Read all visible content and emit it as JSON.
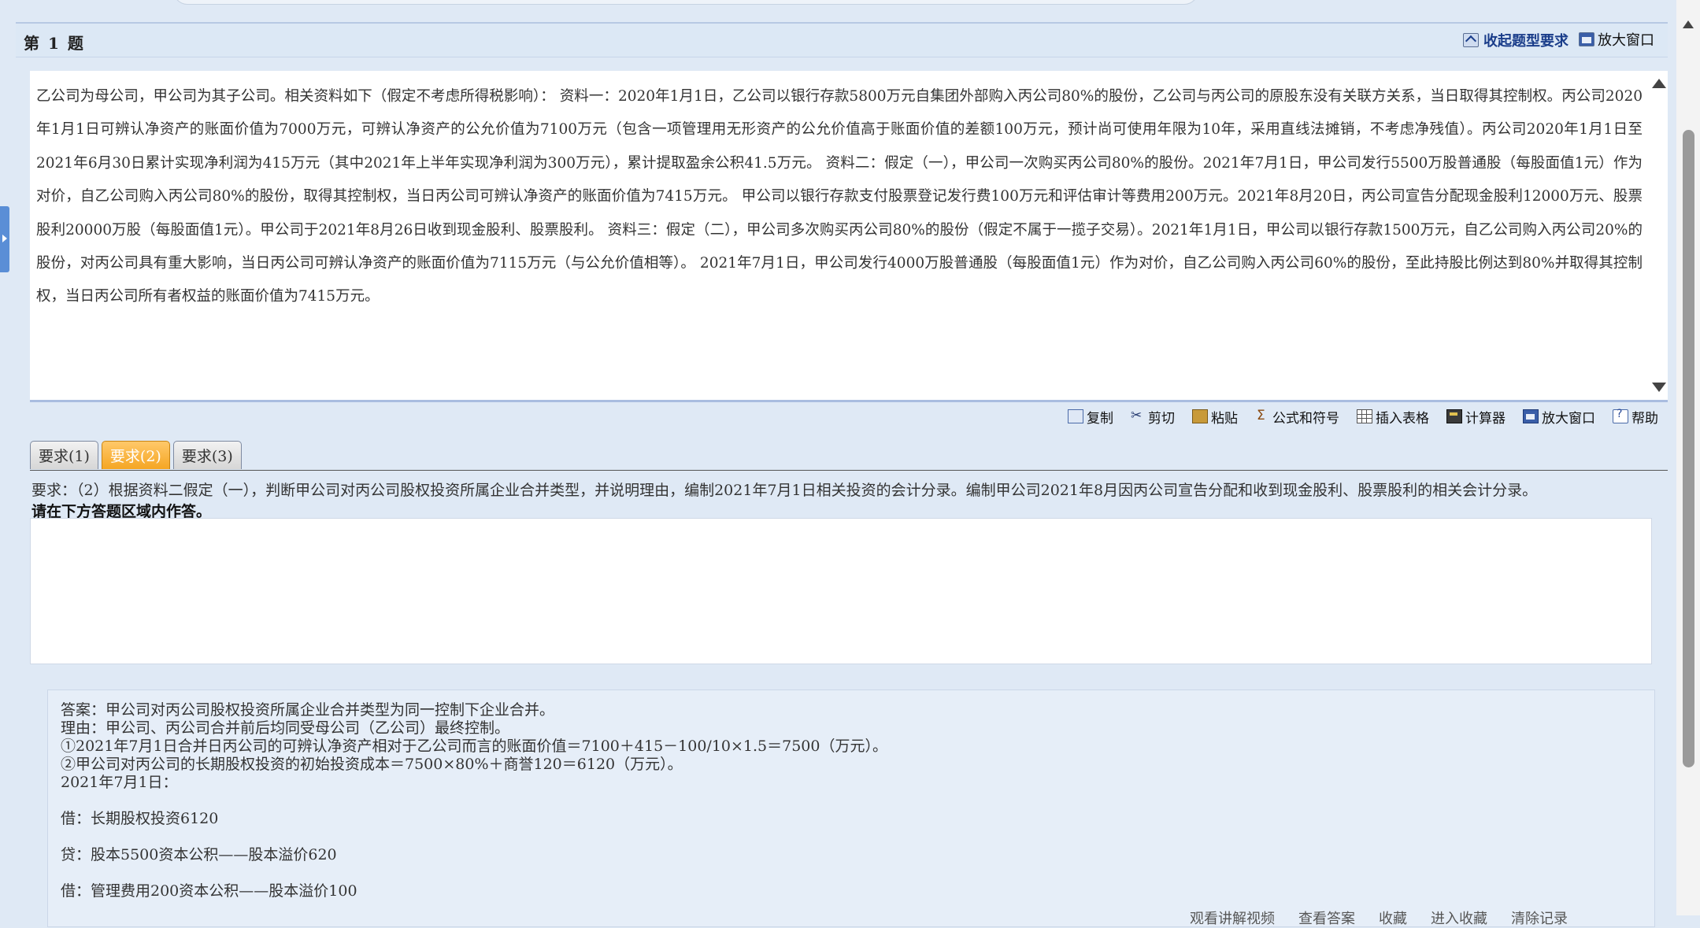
{
  "header": {
    "question_no": "第 1 题",
    "collapse_label": "收起题型要求",
    "enlarge_label": "放大窗口"
  },
  "material": {
    "text": "乙公司为母公司，甲公司为其子公司。相关资料如下（假定不考虑所得税影响）： 资料一：2020年1月1日，乙公司以银行存款5800万元自集团外部购入丙公司80%的股份，乙公司与丙公司的原股东没有关联方关系，当日取得其控制权。丙公司2020年1月1日可辨认净资产的账面价值为7000万元，可辨认净资产的公允价值为7100万元（包含一项管理用无形资产的公允价值高于账面价值的差额100万元，预计尚可使用年限为10年，采用直线法摊销，不考虑净残值）。丙公司2020年1月1日至2021年6月30日累计实现净利润为415万元（其中2021年上半年实现净利润为300万元），累计提取盈余公积41.5万元。 资料二：假定（一），甲公司一次购买丙公司80%的股份。2021年7月1日，甲公司发行5500万股普通股（每股面值1元）作为对价，自乙公司购入丙公司80%的股份，取得其控制权，当日丙公司可辨认净资产的账面价值为7415万元。 甲公司以银行存款支付股票登记发行费100万元和评估审计等费用200万元。2021年8月20日，丙公司宣告分配现金股利12000万元、股票股利20000万股（每股面值1元）。甲公司于2021年8月26日收到现金股利、股票股利。 资料三：假定（二），甲公司多次购买丙公司80%的股份（假定不属于一揽子交易）。2021年1月1日，甲公司以银行存款1500万元，自乙公司购入丙公司20%的股份，对丙公司具有重大影响，当日丙公司可辨认净资产的账面价值为7115万元（与公允价值相等）。 2021年7月1日，甲公司发行4000万股普通股（每股面值1元）作为对价，自乙公司购入丙公司60%的股份，至此持股比例达到80%并取得其控制权，当日丙公司所有者权益的账面价值为7415万元。"
  },
  "toolbar": {
    "copy": "复制",
    "cut": "剪切",
    "paste": "粘贴",
    "formula": "公式和符号",
    "insert_table": "插入表格",
    "calculator": "计算器",
    "enlarge": "放大窗口",
    "help": "帮助"
  },
  "tabs": [
    {
      "label": "要求(1)",
      "active": false
    },
    {
      "label": "要求(2)",
      "active": true
    },
    {
      "label": "要求(3)",
      "active": false
    }
  ],
  "requirement": {
    "text": "要求：（2）根据资料二假定（一），判断甲公司对丙公司股权投资所属企业合并类型，并说明理由，编制2021年7月1日相关投资的会计分录。编制甲公司2021年8月因丙公司宣告分配和收到现金股利、股票股利的相关会计分录。",
    "hint": "请在下方答题区域内作答。"
  },
  "answer": {
    "lines": [
      "答案：甲公司对丙公司股权投资所属企业合并类型为同一控制下企业合并。",
      "理由：甲公司、丙公司合并前后均同受母公司（乙公司）最终控制。",
      "①2021年7月1日合并日丙公司的可辨认净资产相对于乙公司而言的账面价值＝7100＋415－100/10×1.5＝7500（万元）。",
      "②甲公司对丙公司的长期股权投资的初始投资成本＝7500×80%＋商誉120＝6120（万元）。",
      "2021年7月1日：",
      "",
      "借：长期股权投资6120",
      "",
      "贷：股本5500资本公积——股本溢价620",
      "",
      "借：管理费用200资本公积——股本溢价100"
    ],
    "bottom_links": [
      "观看讲解视频",
      "查看答案",
      "收藏",
      "进入收藏",
      "清除记录"
    ]
  }
}
